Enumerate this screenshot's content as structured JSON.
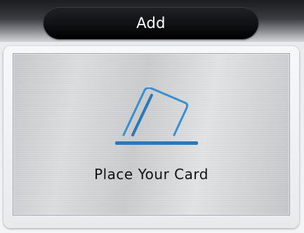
{
  "header": {
    "title": "Add"
  },
  "main": {
    "prompt": "Place Your Card",
    "icon": "card-swipe-icon"
  },
  "colors": {
    "accent": "#2f7fc0",
    "accent_dark": "#1d5f97"
  }
}
